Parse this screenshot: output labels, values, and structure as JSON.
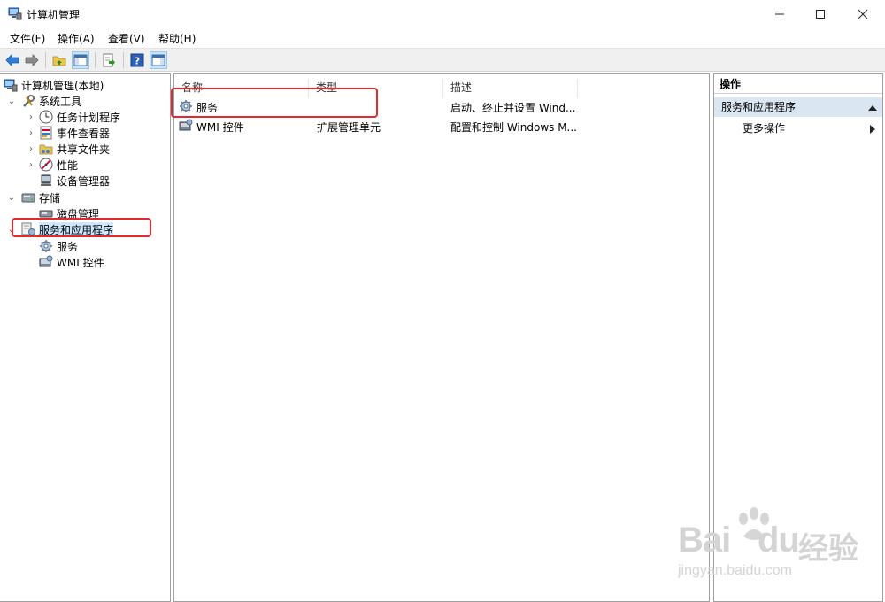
{
  "window": {
    "title": "计算机管理"
  },
  "menu": [
    "文件(F)",
    "操作(A)",
    "查看(V)",
    "帮助(H)"
  ],
  "tree": {
    "root": "计算机管理(本地)",
    "system_tools": "系统工具",
    "task_scheduler": "任务计划程序",
    "event_viewer": "事件查看器",
    "shared_folders": "共享文件夹",
    "performance": "性能",
    "device_manager": "设备管理器",
    "storage": "存储",
    "disk_management": "磁盘管理",
    "services_apps": "服务和应用程序",
    "services": "服务",
    "wmi": "WMI 控件"
  },
  "list": {
    "columns": [
      "名称",
      "类型",
      "描述"
    ],
    "rows": [
      {
        "name": "服务",
        "type": "",
        "desc": "启动、终止并设置 Wind..."
      },
      {
        "name": "WMI 控件",
        "type": "扩展管理单元",
        "desc": "配置和控制 Windows M..."
      }
    ]
  },
  "actions": {
    "header": "操作",
    "section": "服务和应用程序",
    "more": "更多操作"
  },
  "watermark": {
    "logo_a": "Bai",
    "logo_b": "du",
    "jingyan": "经验",
    "url": "jingyan.baidu.com"
  },
  "colors": {
    "annotation": "#e8262d",
    "selection": "#cde8ff",
    "action_header": "#dbe6f3"
  }
}
